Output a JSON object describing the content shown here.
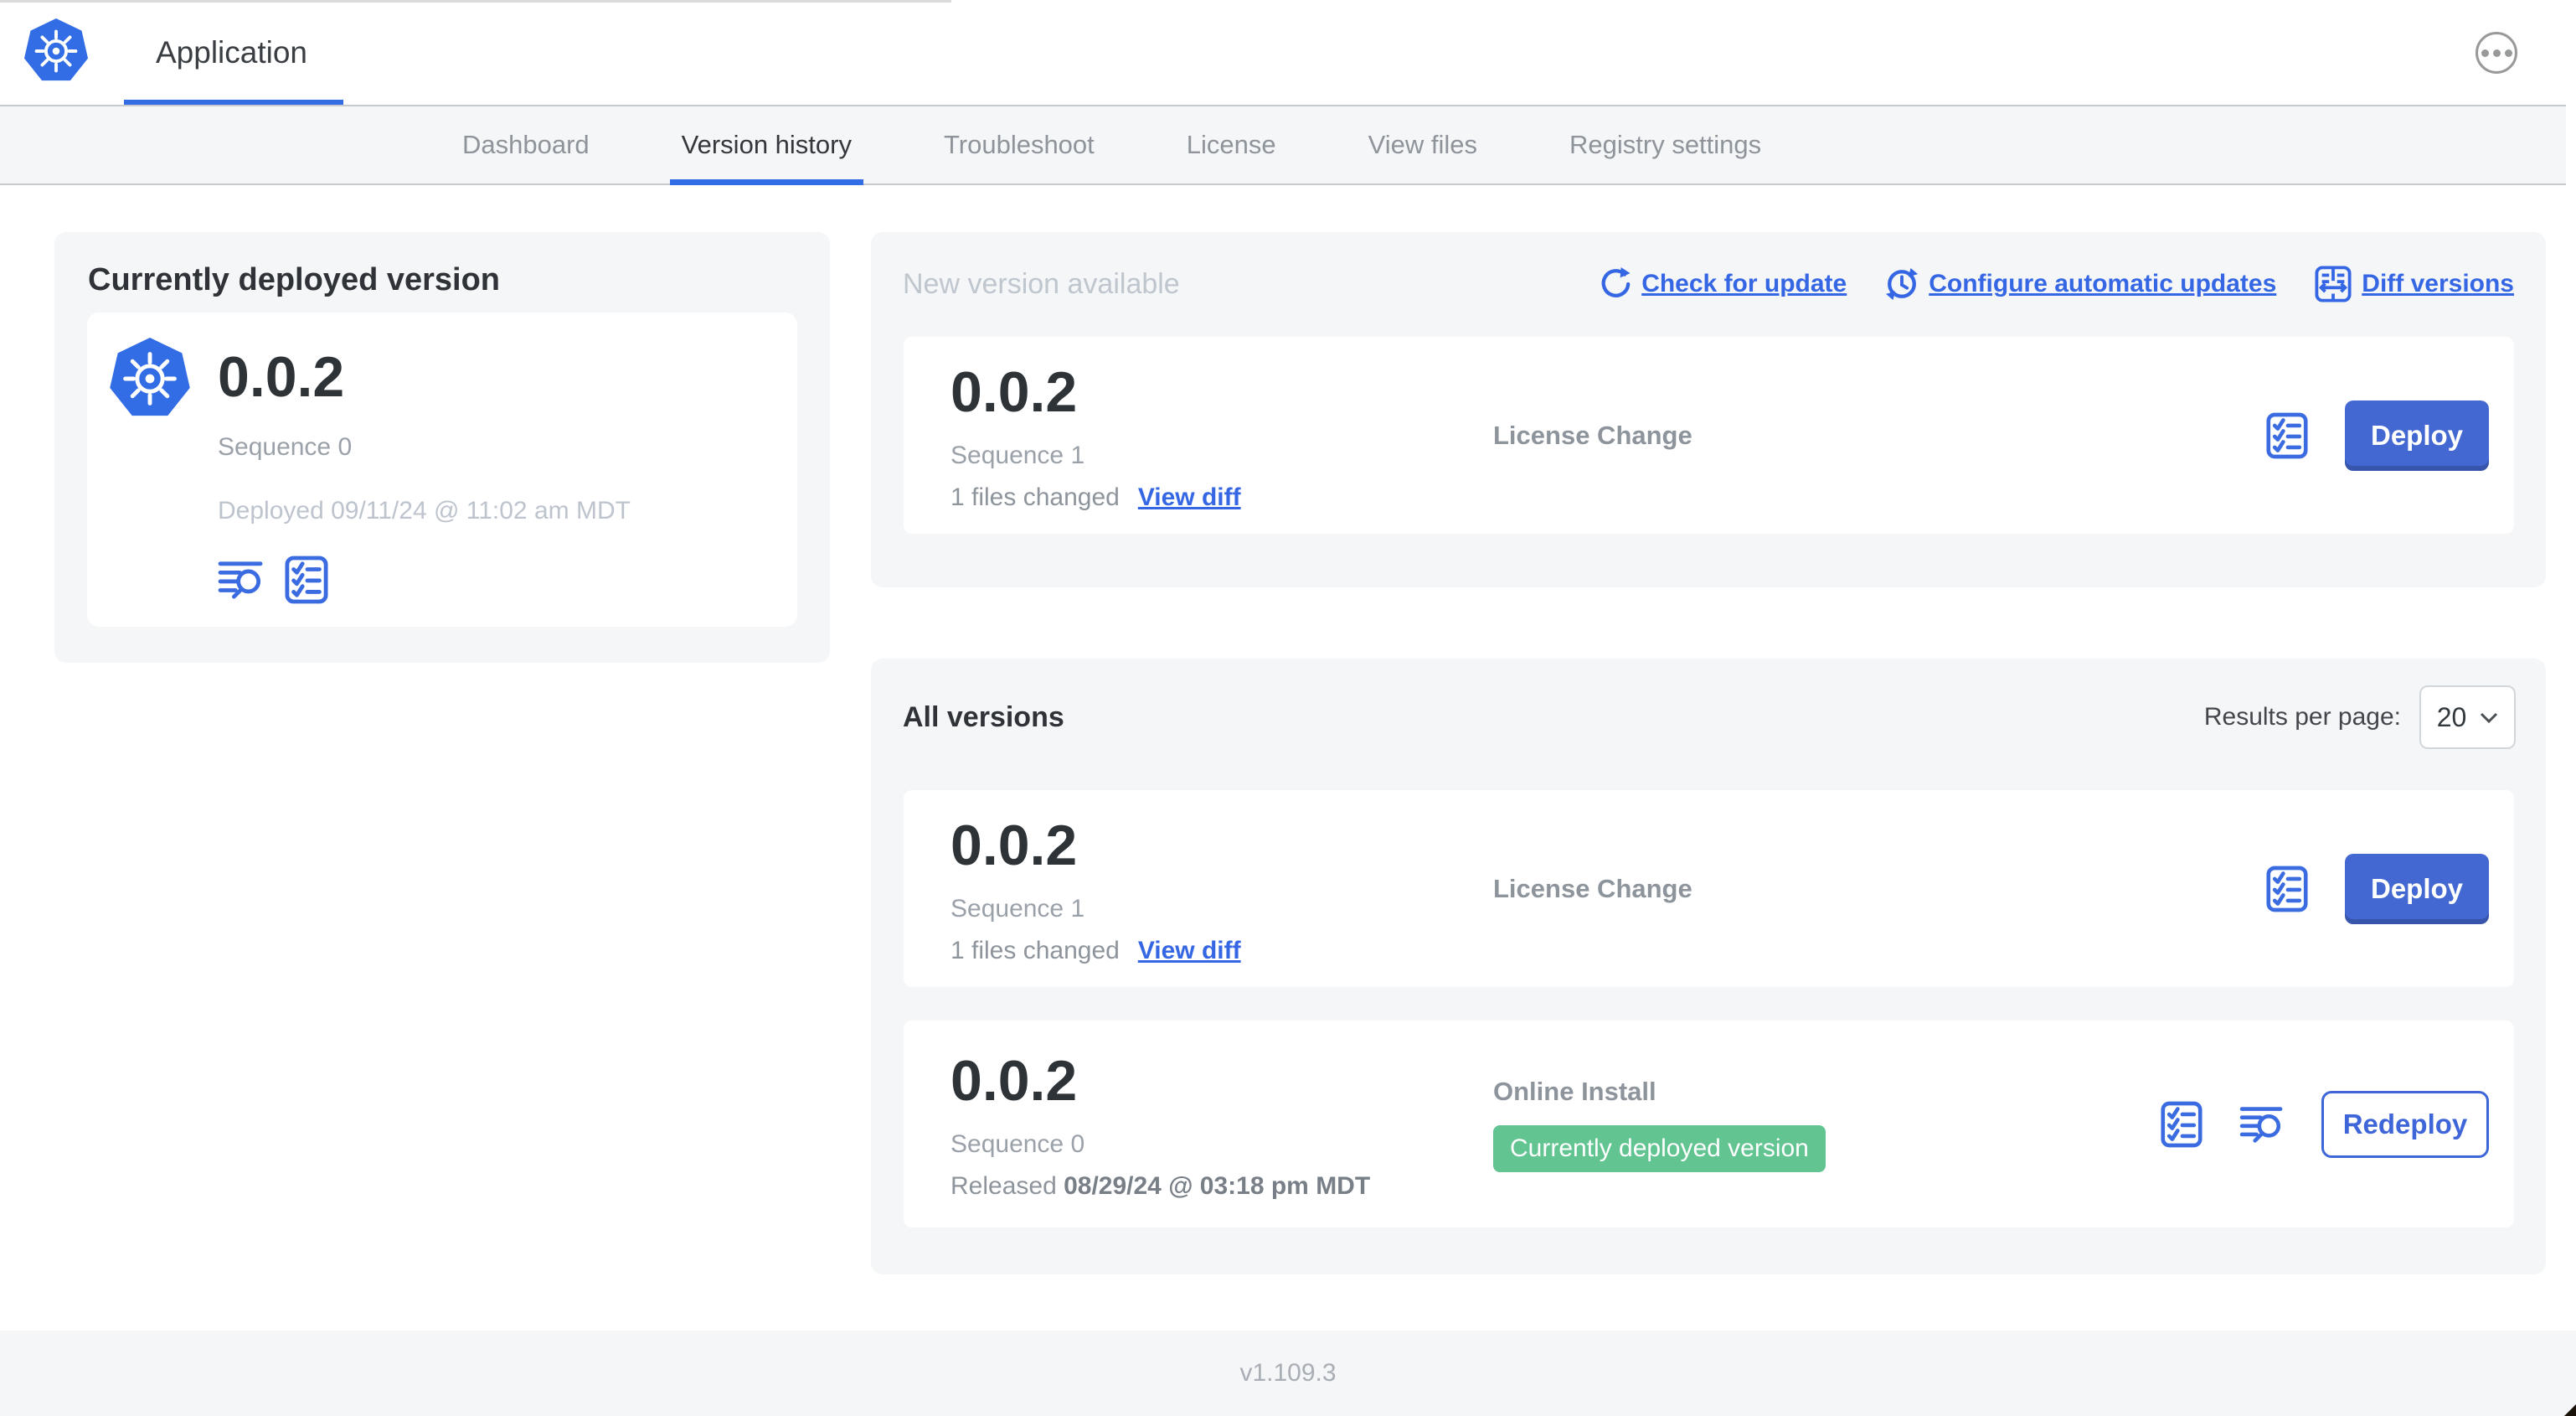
{
  "header": {
    "app_title": "Application",
    "menu_icon": "ellipsis-icon"
  },
  "nav": {
    "tabs": [
      {
        "label": "Dashboard",
        "active": false
      },
      {
        "label": "Version history",
        "active": true
      },
      {
        "label": "Troubleshoot",
        "active": false
      },
      {
        "label": "License",
        "active": false
      },
      {
        "label": "View files",
        "active": false
      },
      {
        "label": "Registry settings",
        "active": false
      }
    ]
  },
  "current_version_panel": {
    "title": "Currently deployed version",
    "version": "0.0.2",
    "sequence": "Sequence 0",
    "deployed": "Deployed 09/11/24 @ 11:02 am MDT",
    "icons": [
      "logs-icon",
      "checklist-icon"
    ],
    "app_icon": "kubernetes-logo-icon"
  },
  "new_version_panel": {
    "title": "New version available",
    "actions": {
      "check_for_update": "Check for update",
      "check_icon": "refresh-icon",
      "configure_automatic_updates": "Configure automatic updates",
      "configure_icon": "auto-update-clock-icon",
      "diff_versions": "Diff versions",
      "diff_icon": "diff-columns-icon"
    },
    "row": {
      "number": "0.0.2",
      "sequence": "Sequence 1",
      "files_changed": "1 files changed",
      "view_diff": "View diff",
      "source": "License Change",
      "action": "Deploy",
      "icons": [
        "checklist-icon"
      ]
    }
  },
  "all_versions_panel": {
    "title": "All versions",
    "results_per_page_label": "Results per page:",
    "results_per_page_value": "20",
    "rows": [
      {
        "number": "0.0.2",
        "sequence": "Sequence 1",
        "files_changed": "1 files changed",
        "view_diff": "View diff",
        "source": "License Change",
        "action": "Deploy",
        "icons": [
          "checklist-icon"
        ]
      },
      {
        "number": "0.0.2",
        "sequence": "Sequence 0",
        "released_prefix": "Released ",
        "released_date": "08/29/24 @ 03:18 pm MDT",
        "source": "Online Install",
        "badge": "Currently deployed version",
        "action": "Redeploy",
        "icons": [
          "checklist-icon",
          "logs-icon"
        ]
      }
    ]
  },
  "footer": {
    "app_version": "v1.109.3"
  },
  "colors": {
    "accent_blue": "#326de6",
    "link_blue": "#3566e3",
    "button_blue": "#4468d1",
    "badge_green": "#61c491",
    "panel_gray": "#f4f6f8",
    "muted_text": "#9aa1a9",
    "faint_text": "#bdc4cd"
  }
}
